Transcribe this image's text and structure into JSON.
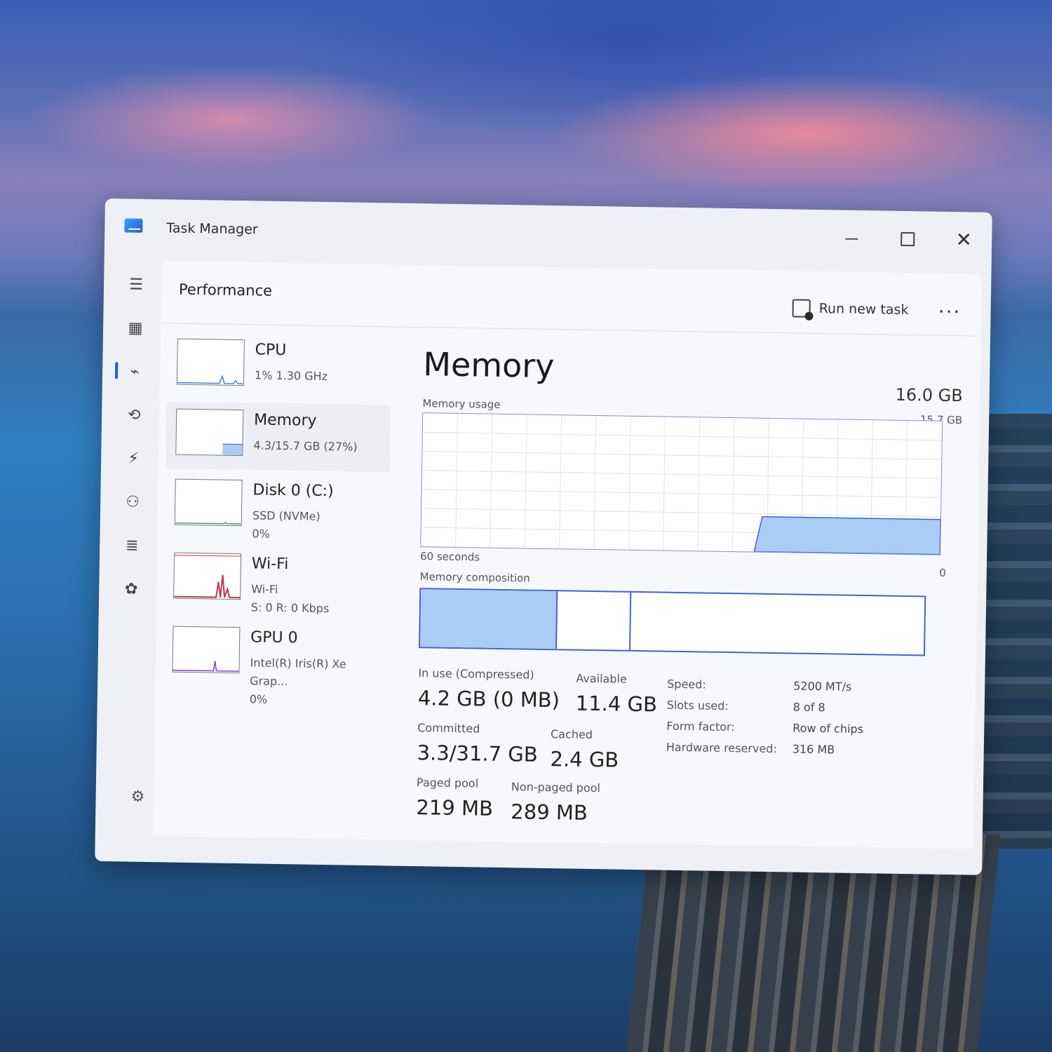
{
  "window": {
    "title": "Task Manager"
  },
  "header": {
    "title": "Performance",
    "run_new_task": "Run new task",
    "more": "..."
  },
  "perf_list": [
    {
      "name": "CPU",
      "line1": "1%  1.30 GHz",
      "line2": "",
      "line3": ""
    },
    {
      "name": "Memory",
      "line1": "4.3/15.7 GB (27%)",
      "line2": "",
      "line3": ""
    },
    {
      "name": "Disk 0 (C:)",
      "line1": "SSD (NVMe)",
      "line2": "0%",
      "line3": ""
    },
    {
      "name": "Wi-Fi",
      "line1": "Wi-Fi",
      "line2": "S: 0  R: 0 Kbps",
      "line3": ""
    },
    {
      "name": "GPU 0",
      "line1": "Intel(R) Iris(R) Xe Grap...",
      "line2": "0%",
      "line3": ""
    }
  ],
  "memory": {
    "title": "Memory",
    "total": "16.0 GB",
    "usage_label": "Memory usage",
    "usage_max": "15.7 GB",
    "time_label": "60 seconds",
    "zero_label": "0",
    "composition_label": "Memory composition",
    "composition": {
      "in_use_fraction": 0.27,
      "modified_fraction": 0.145,
      "standby_fraction": 0.585
    },
    "stats": {
      "in_use_label": "In use (Compressed)",
      "in_use_value": "4.2 GB (0 MB)",
      "available_label": "Available",
      "available_value": "11.4 GB",
      "committed_label": "Committed",
      "committed_value": "3.3/31.7 GB",
      "cached_label": "Cached",
      "cached_value": "2.4 GB",
      "paged_label": "Paged pool",
      "paged_value": "219 MB",
      "nonpaged_label": "Non-paged pool",
      "nonpaged_value": "289 MB"
    },
    "details": {
      "speed_label": "Speed:",
      "speed_value": "5200 MT/s",
      "slots_label": "Slots used:",
      "slots_value": "8 of 8",
      "form_label": "Form factor:",
      "form_value": "Row of chips",
      "hw_label": "Hardware reserved:",
      "hw_value": "316 MB"
    }
  },
  "icons": {
    "rail": [
      "hamburger-icon",
      "processes-icon",
      "performance-icon",
      "app-history-icon",
      "startup-apps-icon",
      "users-icon",
      "details-icon",
      "services-icon"
    ],
    "settings": "settings-icon"
  },
  "colors": {
    "accent": "#1f5fcf",
    "memory_fill": "#a9cdf5",
    "memory_border": "#4a5fd0"
  }
}
